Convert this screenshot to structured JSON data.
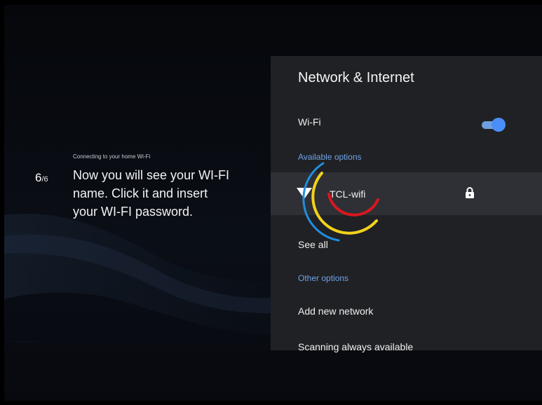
{
  "step": {
    "caption": "Connecting to your home Wi-Fi",
    "number": "6",
    "total": "/6",
    "instruction": "Now you will see your WI-FI name. Click it and insert your WI-FI password."
  },
  "panel": {
    "title": "Network & Internet",
    "wifi_label": "Wi-Fi",
    "wifi_enabled": true,
    "available_label": "Available options",
    "network_name": "TCL-wifi",
    "network_secured": true,
    "see_all": "See all",
    "other_label": "Other options",
    "add_network": "Add new network",
    "scanning": "Scanning always available"
  },
  "colors": {
    "accent": "#4c8ef7",
    "section": "#6fa3e8",
    "panel_bg": "#202124",
    "selected_bg": "#2e3035",
    "spinner": [
      "#1f8fe0",
      "#f2d21c",
      "#d8171f"
    ]
  },
  "icons": [
    "wifi-icon",
    "lock-icon",
    "loading-spinner-icon"
  ]
}
